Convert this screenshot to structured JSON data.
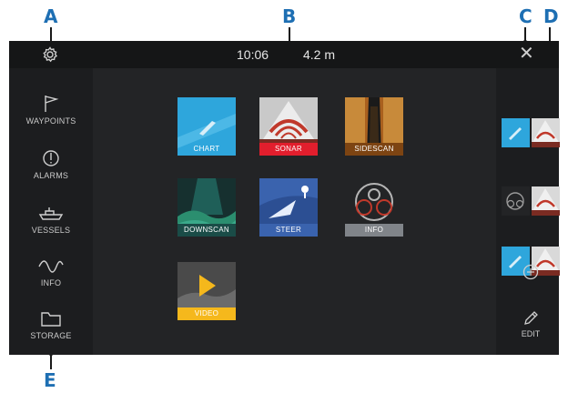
{
  "callouts": {
    "a": "A",
    "b": "B",
    "c": "C",
    "d": "D",
    "e": "E"
  },
  "status": {
    "time": "10:06",
    "depth": "4.2 m"
  },
  "icons": {
    "settings": "gear-icon",
    "close": "close-icon",
    "add": "plus-circle-icon",
    "edit": "pencil-icon"
  },
  "topbar": {
    "close_glyph": "✕"
  },
  "sidebar": {
    "items": [
      {
        "label": "WAYPOINTS",
        "icon": "flag-icon"
      },
      {
        "label": "ALARMS",
        "icon": "alarm-icon"
      },
      {
        "label": "VESSELS",
        "icon": "vessel-icon"
      },
      {
        "label": "INFO",
        "icon": "waveform-icon"
      },
      {
        "label": "STORAGE",
        "icon": "folder-icon"
      }
    ]
  },
  "apps": [
    {
      "label": "CHART",
      "color": "#2ea6dc"
    },
    {
      "label": "SONAR",
      "color": "#e21e2d"
    },
    {
      "label": "SIDESCAN",
      "color": "#a9601e"
    },
    {
      "label": "DOWNSCAN",
      "color": "#1f5f58"
    },
    {
      "label": "STEER",
      "color": "#3a63ae"
    },
    {
      "label": "INFO",
      "color": "#808489"
    },
    {
      "label": "VIDEO",
      "color": "#f5b81c"
    }
  ],
  "favorites": [
    {
      "name": "chart-sonar-combo"
    },
    {
      "name": "gauges-sonar-combo"
    },
    {
      "name": "chart-sonar-combo"
    }
  ],
  "rightbar": {
    "edit_label": "EDIT"
  }
}
